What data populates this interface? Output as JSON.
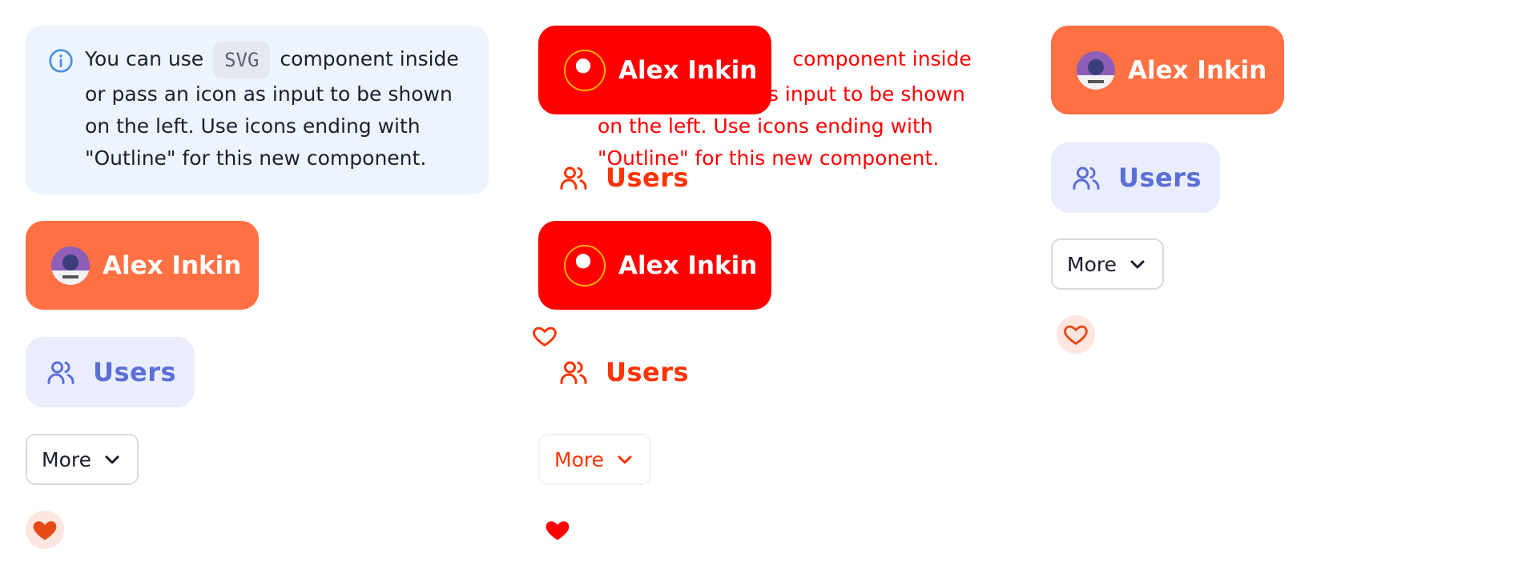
{
  "theme": {
    "accent_orange": "#ff7043",
    "user_chip_bg": "#ff7043",
    "users_pill_bg": "#e9edfd",
    "users_pill_text": "#5b6fd6",
    "highlight_red": "#ff0000",
    "heart_fill": "#e64a19",
    "heart_bg": "#fde6dd",
    "alert_bg": "#eef4fe",
    "info_icon_color": "#4a90e2"
  },
  "alert": {
    "text_before": "You can use ",
    "code": "SVG",
    "text_after": " component inside or pass an icon as input to be shown on the left. Use icons ending with \"Outline\" for this new component.",
    "icon": "info-circle-icon"
  },
  "user_chip": {
    "name": "Alex Inkin",
    "avatar_icon": "user-avatar"
  },
  "users_button": {
    "label": "Users",
    "icon": "users-group-icon"
  },
  "more_button": {
    "label": "More",
    "icon": "chevron-down-icon"
  },
  "favorite": {
    "icon": "heart-icon"
  }
}
